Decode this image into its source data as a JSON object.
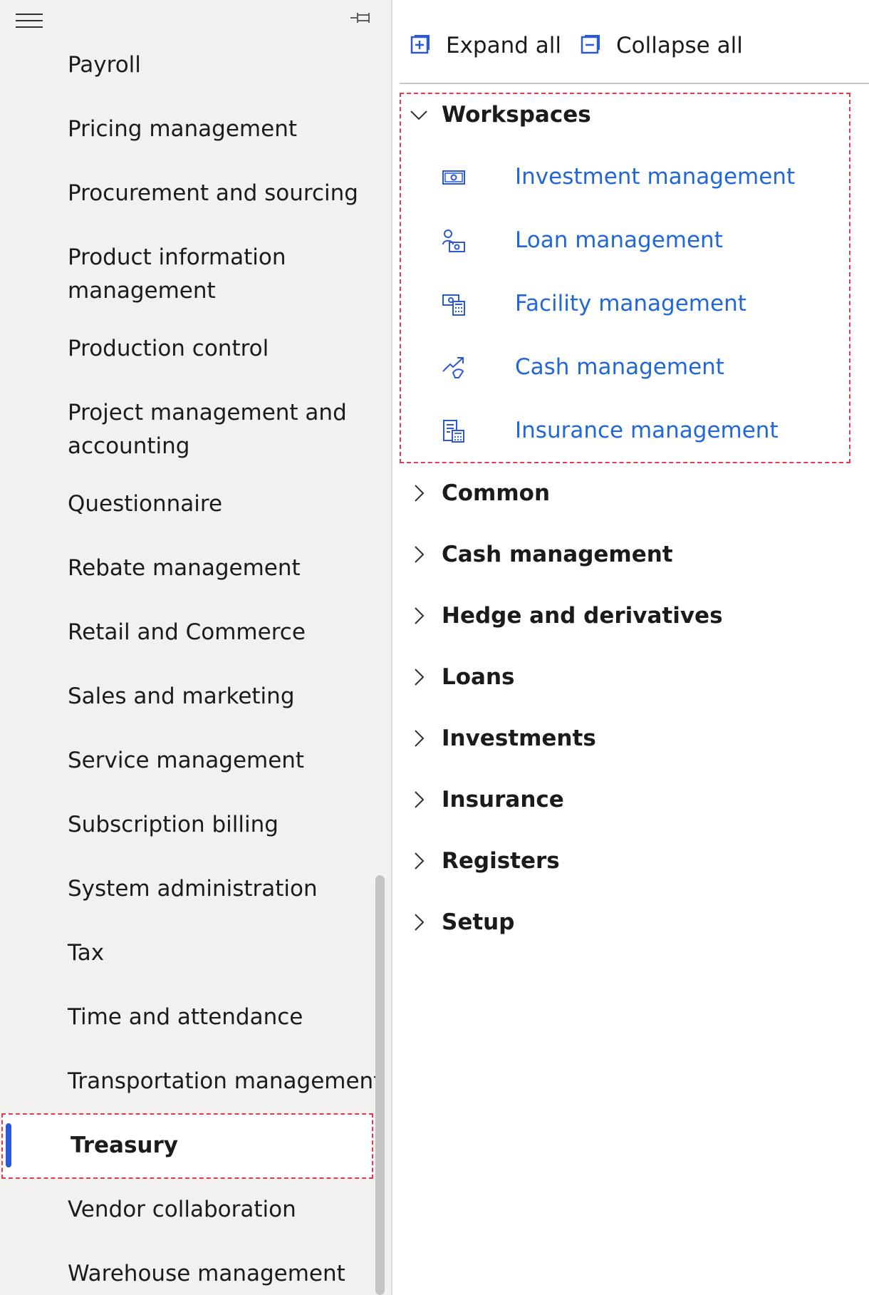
{
  "nav": {
    "items": [
      {
        "label": "Payroll"
      },
      {
        "label": "Pricing management"
      },
      {
        "label": "Procurement and sourcing"
      },
      {
        "label": "Product information"
      },
      {
        "label": "management"
      },
      {
        "label": "Production control"
      },
      {
        "label": "Project management and"
      },
      {
        "label": "accounting"
      },
      {
        "label": "Questionnaire"
      },
      {
        "label": "Rebate management"
      },
      {
        "label": "Retail and Commerce"
      },
      {
        "label": "Sales and marketing"
      },
      {
        "label": "Service management"
      },
      {
        "label": "Subscription billing"
      },
      {
        "label": "System administration"
      },
      {
        "label": "Tax"
      },
      {
        "label": "Time and attendance"
      },
      {
        "label": "Transportation management"
      },
      {
        "label": "Treasury"
      },
      {
        "label": "Vendor collaboration"
      },
      {
        "label": "Warehouse management"
      }
    ],
    "selected": "Treasury"
  },
  "toolbar": {
    "expand_label": "Expand all",
    "collapse_label": "Collapse all"
  },
  "workspaces": {
    "title": "Workspaces",
    "links": [
      {
        "label": "Investment management",
        "icon": "money-icon"
      },
      {
        "label": "Loan management",
        "icon": "person-money-icon"
      },
      {
        "label": "Facility management",
        "icon": "calculator-money-icon"
      },
      {
        "label": "Cash management",
        "icon": "trend-arrow-icon"
      },
      {
        "label": "Insurance management",
        "icon": "document-calculator-icon"
      }
    ]
  },
  "groups": [
    {
      "label": "Common"
    },
    {
      "label": "Cash management"
    },
    {
      "label": "Hedge and derivatives"
    },
    {
      "label": "Loans"
    },
    {
      "label": "Investments"
    },
    {
      "label": "Insurance"
    },
    {
      "label": "Registers"
    },
    {
      "label": "Setup"
    }
  ],
  "colors": {
    "accent": "#2b58d9",
    "link": "#2267d8",
    "highlight": "#e8374b",
    "nav_bg": "#f2f1f0"
  }
}
